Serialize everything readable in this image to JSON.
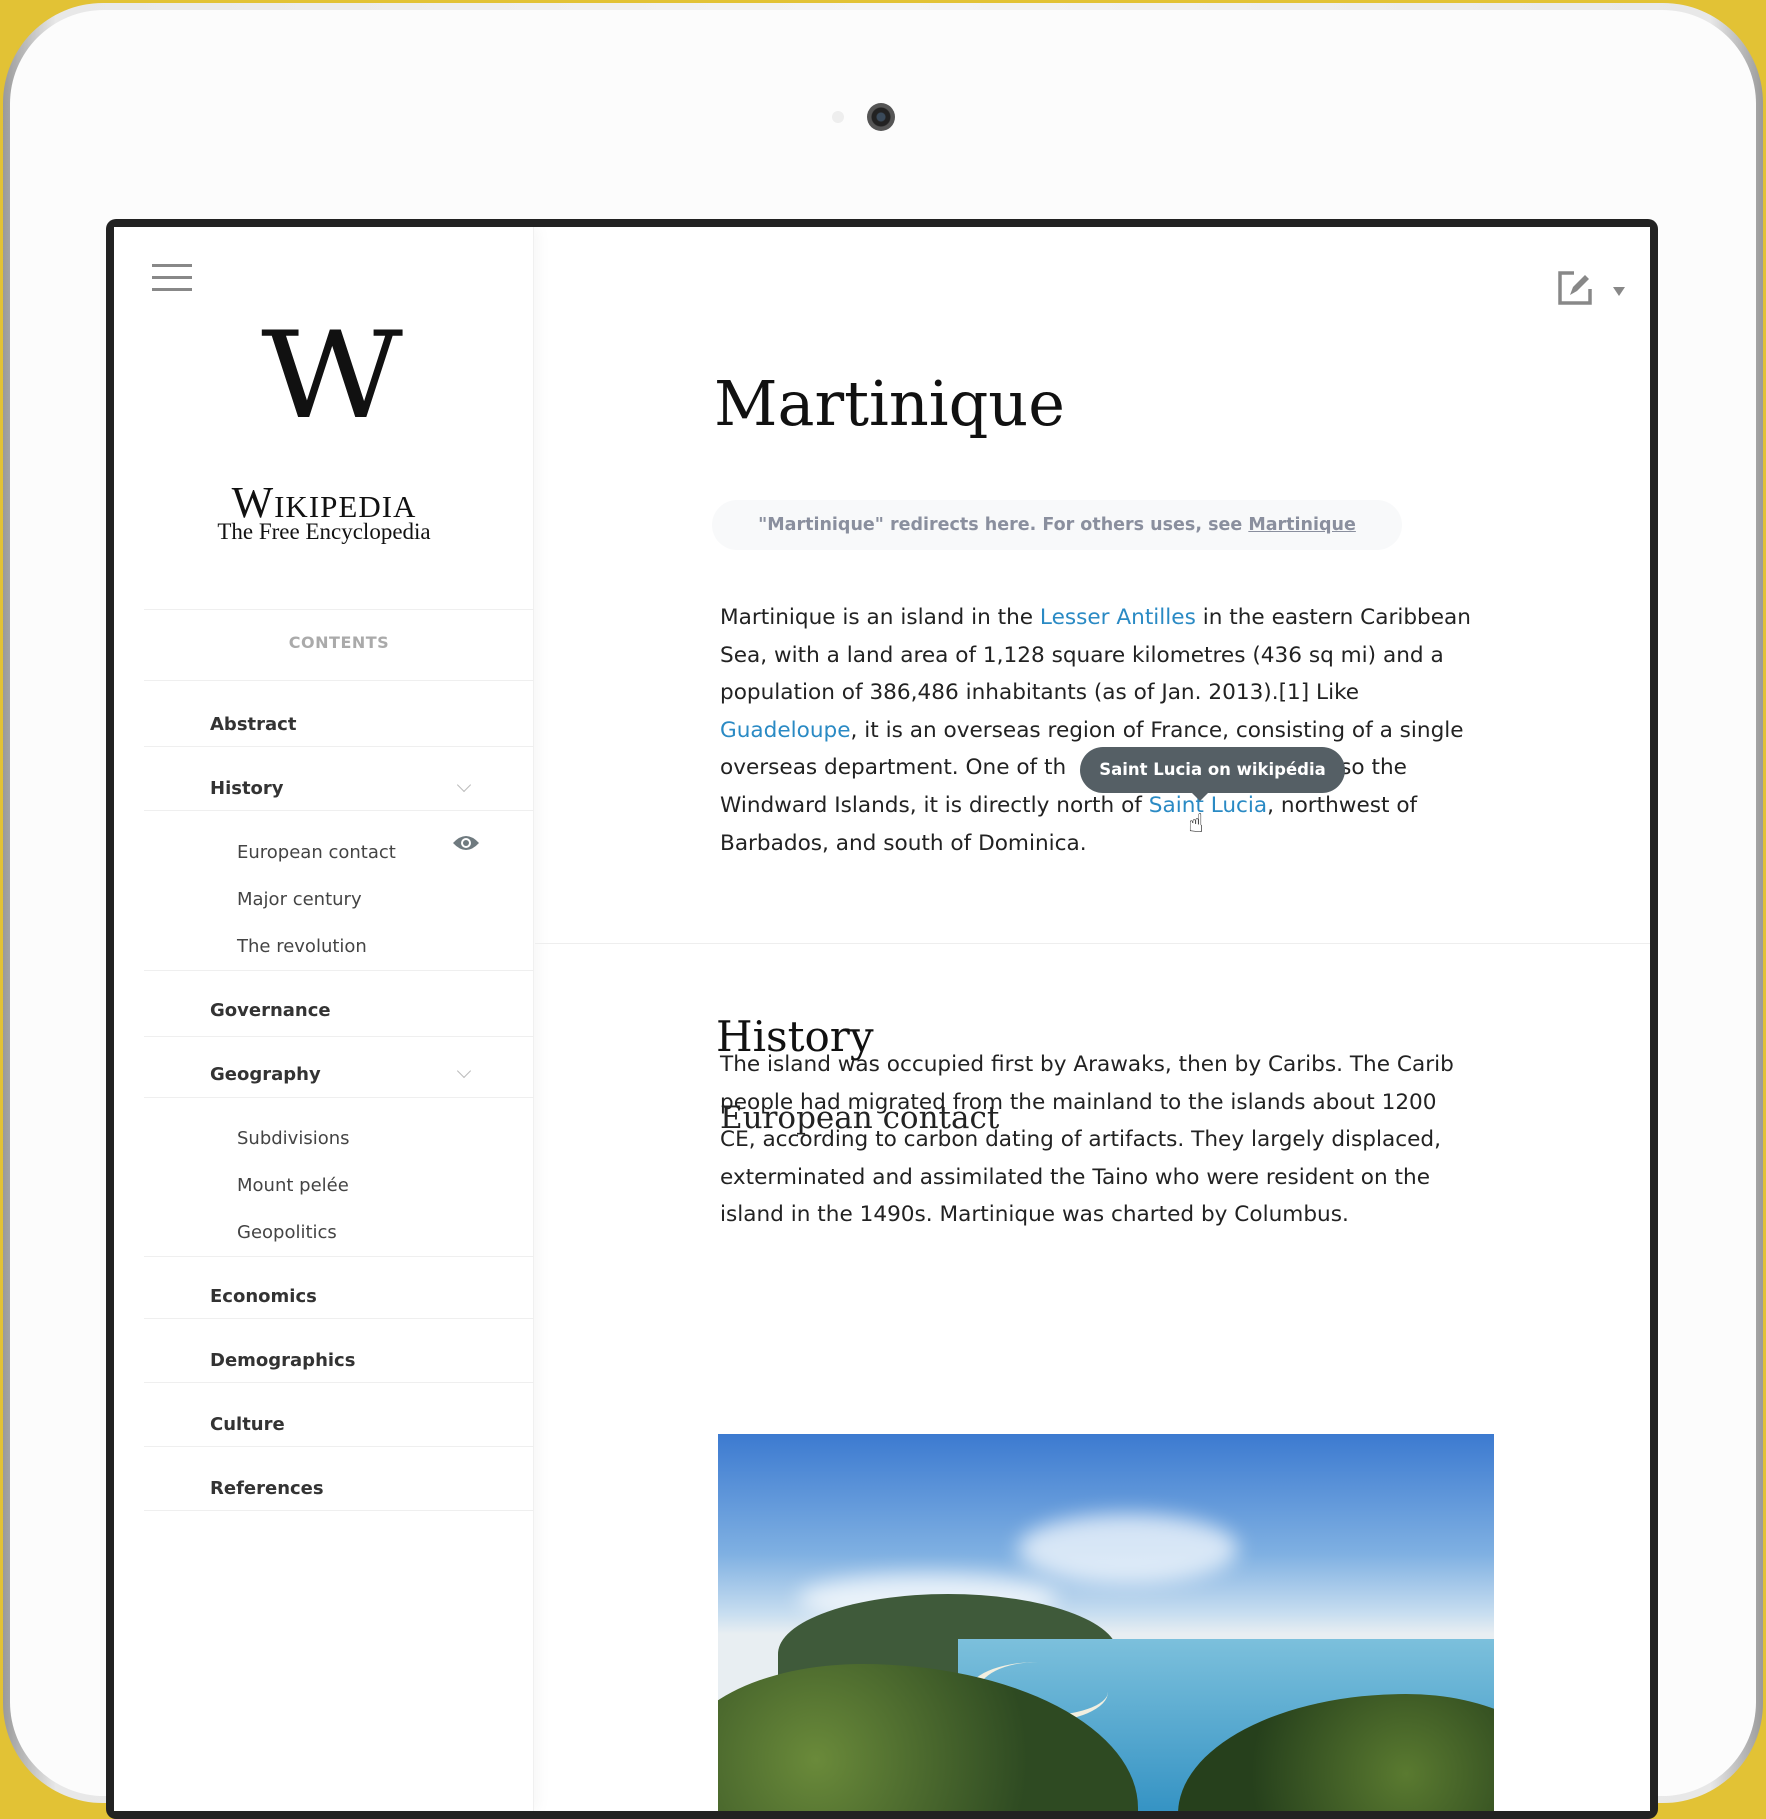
{
  "sidebar": {
    "logo": {
      "name": "Wikipedia",
      "tagline": "The Free Encyclopedia",
      "glyph": "W"
    },
    "contents_label": "CONTENTS",
    "items": [
      {
        "label": "Abstract"
      },
      {
        "label": "History",
        "expandable": true
      },
      {
        "label": "European contact",
        "sub": true,
        "current": true
      },
      {
        "label": "Major century",
        "sub": true
      },
      {
        "label": "The revolution",
        "sub": true
      },
      {
        "label": "Governance"
      },
      {
        "label": "Geography",
        "expandable": true
      },
      {
        "label": "Subdivisions",
        "sub": true
      },
      {
        "label": "Mount pelée",
        "sub": true
      },
      {
        "label": "Geopolitics",
        "sub": true
      },
      {
        "label": "Economics"
      },
      {
        "label": "Demographics"
      },
      {
        "label": "Culture"
      },
      {
        "label": "References"
      }
    ]
  },
  "toolbar": {
    "edit_icon": "edit-icon",
    "dropdown_icon": "caret-down-icon"
  },
  "article": {
    "title": "Martinique",
    "redirect": {
      "text": "\"Martinique\" redirects here. For others uses, see ",
      "link": "Martinique"
    },
    "intro": {
      "l1a": "Martinique is an island in the ",
      "l1link": "Lesser Antilles",
      "l1b": " in the eastern Caribbean",
      "l2": "Sea, with a land area of 1,128 square kilometres (436 sq mi) and a",
      "l3": "population of 386,486 inhabitants (as of Jan. 2013).[1] Like",
      "l4link": "Guadeloupe",
      "l4b": ", it is an overseas region of France, consisting of a single",
      "l5a": "overseas department. One of th",
      "l5b": "lso the",
      "l6a": "Windward Islands, it is directly north of ",
      "l6link": "Saint Lucia",
      "l6b": ", northwest of",
      "l7": "Barbados, and south of Dominica."
    },
    "tooltip": "Saint Lucia on wikipédia",
    "section": "History",
    "subsection": "European contact",
    "history_lines": [
      "The island was occupied first by Arawaks, then by Caribs. The Carib",
      "people had migrated from the mainland to the islands about 1200",
      "CE, according to carbon dating of artifacts. They largely displaced,",
      "exterminated and assimilated the Taino who were resident on the",
      "island in the 1490s. Martinique was charted by Columbus."
    ]
  },
  "colors": {
    "link": "#2a8ac4",
    "tooltip": "#555f65",
    "frame": "#e2c235"
  }
}
